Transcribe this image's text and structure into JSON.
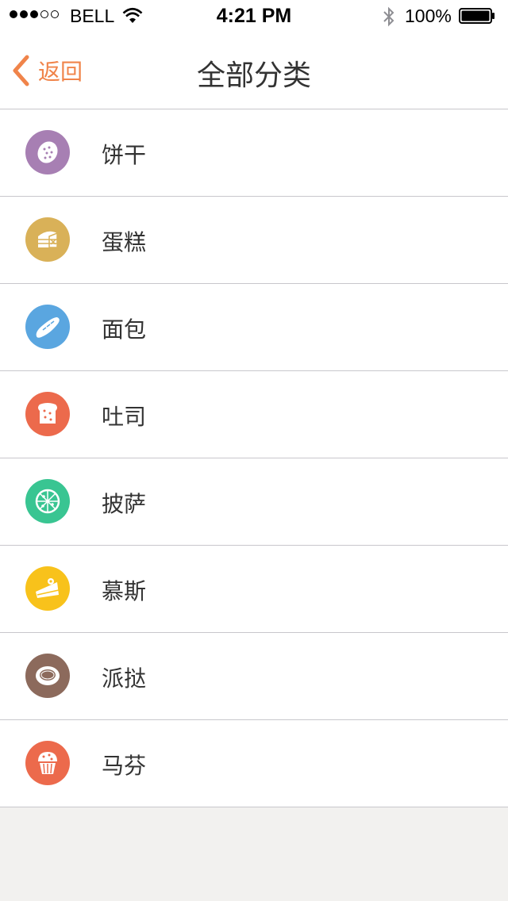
{
  "status_bar": {
    "carrier": "BELL",
    "time": "4:21 PM",
    "battery": "100%"
  },
  "nav": {
    "back_label": "返回",
    "title": "全部分类"
  },
  "colors": {
    "accent": "#f0844a"
  },
  "categories": [
    {
      "label": "饼干",
      "icon": "cookie-icon",
      "color": "#a77fb3"
    },
    {
      "label": "蛋糕",
      "icon": "cake-icon",
      "color": "#d9b158"
    },
    {
      "label": "面包",
      "icon": "bread-icon",
      "color": "#5aa6e0"
    },
    {
      "label": "吐司",
      "icon": "toast-icon",
      "color": "#ec6a4c"
    },
    {
      "label": "披萨",
      "icon": "pizza-icon",
      "color": "#39c592"
    },
    {
      "label": "慕斯",
      "icon": "mousse-icon",
      "color": "#f8c21b"
    },
    {
      "label": "派挞",
      "icon": "pie-icon",
      "color": "#8c6a5c"
    },
    {
      "label": "马芬",
      "icon": "muffin-icon",
      "color": "#ec6a4c"
    }
  ]
}
